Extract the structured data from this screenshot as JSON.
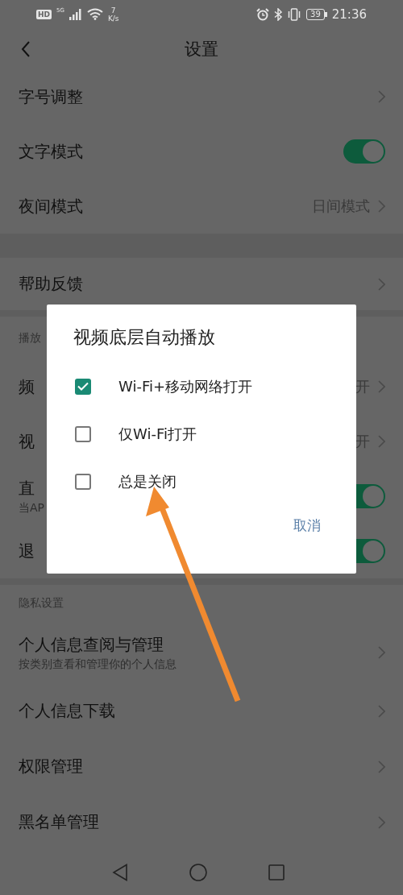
{
  "status_bar": {
    "hd": "HD",
    "network": "5G",
    "speed_value": "7",
    "speed_unit": "K/s",
    "battery": "39",
    "time": "21:36"
  },
  "header": {
    "title": "设置"
  },
  "sections": [
    {
      "items": [
        {
          "kind": "link",
          "label": "字号调整"
        },
        {
          "kind": "toggle",
          "label": "文字模式",
          "on": true
        },
        {
          "kind": "link",
          "label": "夜间模式",
          "value": "日间模式"
        }
      ]
    },
    {
      "items": [
        {
          "kind": "link",
          "label": "帮助反馈"
        }
      ]
    },
    {
      "header": "播放",
      "items": [
        {
          "kind": "link",
          "label": "频",
          "value": "开"
        },
        {
          "kind": "link",
          "label": "视",
          "value": "开"
        },
        {
          "kind": "toggle",
          "label": "直",
          "subtitle": "当AP",
          "on": true
        },
        {
          "kind": "toggle",
          "label": "退",
          "on": true
        }
      ]
    },
    {
      "header": "隐私设置",
      "items": [
        {
          "kind": "link",
          "label": "个人信息查阅与管理",
          "subtitle": "按类别查看和管理你的个人信息"
        },
        {
          "kind": "link",
          "label": "个人信息下载"
        },
        {
          "kind": "link",
          "label": "权限管理"
        },
        {
          "kind": "link",
          "label": "黑名单管理"
        }
      ]
    }
  ],
  "dialog": {
    "title": "视频底层自动播放",
    "options": [
      {
        "label": "Wi-Fi+移动网络打开",
        "selected": true
      },
      {
        "label": "仅Wi-Fi打开",
        "selected": false
      },
      {
        "label": "总是关闭",
        "selected": false
      }
    ],
    "cancel": "取消"
  }
}
